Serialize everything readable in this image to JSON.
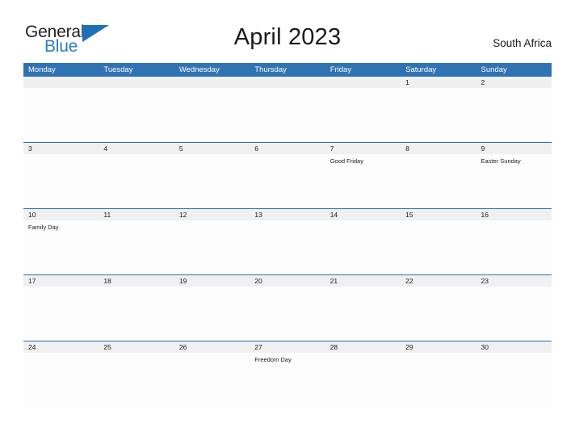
{
  "brand": {
    "name_part1": "General",
    "name_part2": "Blue",
    "triangle_icon": "blue-triangle-logo-mark",
    "accent_color": "#1f6fb6"
  },
  "header": {
    "title": "April 2023",
    "country": "South Africa"
  },
  "theme": {
    "header_blue": "#3073b4",
    "row_separator_blue": "#2e6daf",
    "date_band_gray": "#f0f0f0",
    "text_color": "#1a1a1a",
    "page_background": "#ffffff"
  },
  "calendar": {
    "weekdays": [
      "Monday",
      "Tuesday",
      "Wednesday",
      "Thursday",
      "Friday",
      "Saturday",
      "Sunday"
    ],
    "weeks": [
      {
        "separator": false,
        "days": [
          {
            "date": "",
            "event": ""
          },
          {
            "date": "",
            "event": ""
          },
          {
            "date": "",
            "event": ""
          },
          {
            "date": "",
            "event": ""
          },
          {
            "date": "",
            "event": ""
          },
          {
            "date": "1",
            "event": ""
          },
          {
            "date": "2",
            "event": ""
          }
        ]
      },
      {
        "separator": true,
        "days": [
          {
            "date": "3",
            "event": ""
          },
          {
            "date": "4",
            "event": ""
          },
          {
            "date": "5",
            "event": ""
          },
          {
            "date": "6",
            "event": ""
          },
          {
            "date": "7",
            "event": "Good Friday"
          },
          {
            "date": "8",
            "event": ""
          },
          {
            "date": "9",
            "event": "Easter Sunday"
          }
        ]
      },
      {
        "separator": true,
        "days": [
          {
            "date": "10",
            "event": "Family Day"
          },
          {
            "date": "11",
            "event": ""
          },
          {
            "date": "12",
            "event": ""
          },
          {
            "date": "13",
            "event": ""
          },
          {
            "date": "14",
            "event": ""
          },
          {
            "date": "15",
            "event": ""
          },
          {
            "date": "16",
            "event": ""
          }
        ]
      },
      {
        "separator": true,
        "days": [
          {
            "date": "17",
            "event": ""
          },
          {
            "date": "18",
            "event": ""
          },
          {
            "date": "19",
            "event": ""
          },
          {
            "date": "20",
            "event": ""
          },
          {
            "date": "21",
            "event": ""
          },
          {
            "date": "22",
            "event": ""
          },
          {
            "date": "23",
            "event": ""
          }
        ]
      },
      {
        "separator": true,
        "days": [
          {
            "date": "24",
            "event": ""
          },
          {
            "date": "25",
            "event": ""
          },
          {
            "date": "26",
            "event": ""
          },
          {
            "date": "27",
            "event": "Freedom Day"
          },
          {
            "date": "28",
            "event": ""
          },
          {
            "date": "29",
            "event": ""
          },
          {
            "date": "30",
            "event": ""
          }
        ]
      }
    ]
  }
}
